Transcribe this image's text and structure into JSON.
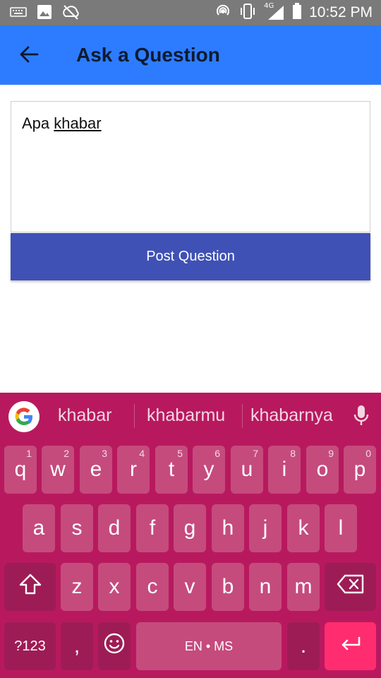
{
  "status_bar": {
    "time": "10:52 PM",
    "network": "4G",
    "icons": [
      "keyboard-icon",
      "image-icon",
      "no-sync-icon",
      "hotspot-icon",
      "vibrate-icon",
      "signal-icon",
      "battery-icon"
    ]
  },
  "app_bar": {
    "title": "Ask a Question",
    "back_icon": "arrow-back-icon",
    "color": "#2d7cff"
  },
  "question": {
    "text_plain": "Apa ",
    "text_underlined": "khabar"
  },
  "post_button": {
    "label": "Post Question",
    "color": "#3f51b5"
  },
  "keyboard": {
    "color": "#b8195e",
    "suggestions": [
      "khabar",
      "khabarmu",
      "khabarnya"
    ],
    "row1": [
      {
        "key": "q",
        "hint": "1"
      },
      {
        "key": "w",
        "hint": "2"
      },
      {
        "key": "e",
        "hint": "3"
      },
      {
        "key": "r",
        "hint": "4"
      },
      {
        "key": "t",
        "hint": "5"
      },
      {
        "key": "y",
        "hint": "6"
      },
      {
        "key": "u",
        "hint": "7"
      },
      {
        "key": "i",
        "hint": "8"
      },
      {
        "key": "o",
        "hint": "9"
      },
      {
        "key": "p",
        "hint": "0"
      }
    ],
    "row2": [
      "a",
      "s",
      "d",
      "f",
      "g",
      "h",
      "j",
      "k",
      "l"
    ],
    "row3": [
      "z",
      "x",
      "c",
      "v",
      "b",
      "n",
      "m"
    ],
    "symbols_label": "?123",
    "comma": ",",
    "space_label": "EN • MS",
    "period": "."
  }
}
